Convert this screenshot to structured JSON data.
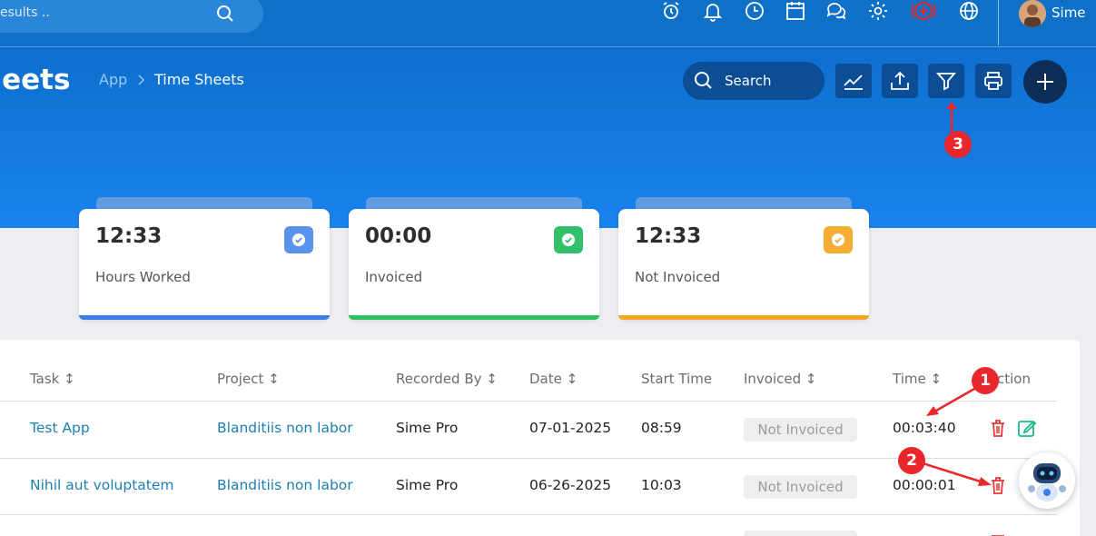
{
  "topbar": {
    "search_placeholder": "esults ..",
    "user_name": "Sime"
  },
  "header": {
    "title": "heets",
    "breadcrumb": {
      "root": "App",
      "separator": ">",
      "current": "Time Sheets"
    },
    "search_label": "Search"
  },
  "stats": [
    {
      "value": "12:33",
      "label": "Hours Worked",
      "color": "#3b7fe6"
    },
    {
      "value": "00:00",
      "label": "Invoiced",
      "color": "#2fbf5c"
    },
    {
      "value": "12:33",
      "label": "Not Invoiced",
      "color": "#f2a623"
    }
  ],
  "table": {
    "headers": [
      "Task ↕",
      "Project ↕",
      "Recorded By ↕",
      "Date ↕",
      "Start Time",
      "Invoiced ↕",
      "Time ↕",
      "ction"
    ],
    "rows": [
      {
        "task": "Test App",
        "project": "Blanditiis non labor",
        "recorded_by": "Sime Pro",
        "date": "07-01-2025",
        "start_time": "08:59",
        "invoiced": "Not Invoiced",
        "time": "00:03:40"
      },
      {
        "task": "Nihil aut voluptatem",
        "project": "Blanditiis non labor",
        "recorded_by": "Sime Pro",
        "date": "06-26-2025",
        "start_time": "10:03",
        "invoiced": "Not Invoiced",
        "time": "00:00:01"
      }
    ]
  },
  "annotations": {
    "m1": "1",
    "m2": "2",
    "m3": "3"
  },
  "colors": {
    "primary": "#0f70c8",
    "marker": "#e8262b",
    "delete": "#e53935",
    "edit": "#1fb981"
  }
}
